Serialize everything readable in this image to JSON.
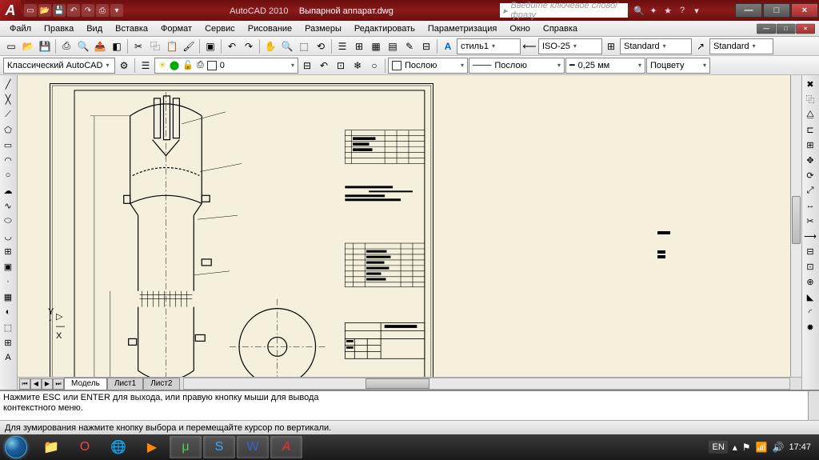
{
  "app": {
    "name": "AutoCAD 2010",
    "file": "Выпарной аппарат.dwg"
  },
  "search": {
    "placeholder": "Введите ключевое слово/фразу"
  },
  "menu": [
    "Файл",
    "Правка",
    "Вид",
    "Вставка",
    "Формат",
    "Сервис",
    "Рисование",
    "Размеры",
    "Редактировать",
    "Параметризация",
    "Окно",
    "Справка"
  ],
  "workspace": {
    "label": "Классический AutoCAD"
  },
  "styles": {
    "textStyle": "стиль1",
    "dimStyle": "ISO-25",
    "tableStyle": "Standard",
    "mleaderStyle": "Standard"
  },
  "props": {
    "layer": "0",
    "color": "Послою",
    "linetype": "Послою",
    "lineweight": "0,25 мм",
    "plotstyle": "Поцвету"
  },
  "tabs": {
    "model": "Модель",
    "sheets": [
      "Лист1",
      "Лист2"
    ]
  },
  "command": {
    "line1": "Нажмите ESC или ENTER для выхода, или правую кнопку мыши для вывода",
    "line2": "контекстного меню."
  },
  "status": {
    "hint": "Для зумирования нажмите кнопку выбора и перемещайте курсор по вертикали."
  },
  "tray": {
    "lang": "EN",
    "time": "17:47"
  },
  "winControls": {
    "min": "—",
    "max": "□",
    "close": "×"
  },
  "drawing": {
    "tableTitle": "Таблица штуцеров",
    "specTitle": "Техническая характеристика"
  }
}
